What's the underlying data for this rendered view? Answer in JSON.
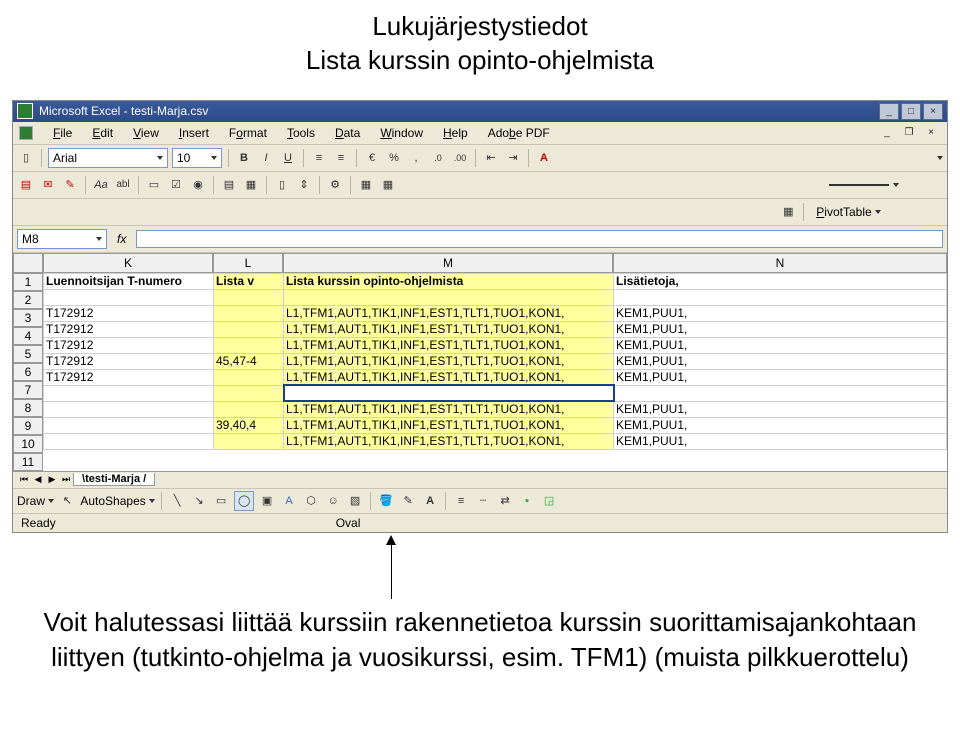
{
  "slide": {
    "title_line1": "Lukujärjestystiedot",
    "title_line2": "Lista kurssin opinto-ohjelmista",
    "caption_line1": "Voit halutessasi liittää kurssiin rakennetietoa kurssin suorittamisajankohtaan",
    "caption_line2": "liittyen (tutkinto-ohjelma ja vuosikurssi, esim. TFM1) (muista pilkkuerottelu)"
  },
  "window": {
    "title": "Microsoft Excel - testi-Marja.csv",
    "minimize": "_",
    "maximize": "□",
    "close": "×"
  },
  "menus": {
    "file": "File",
    "edit": "Edit",
    "view": "View",
    "insert": "Insert",
    "format": "Format",
    "tools": "Tools",
    "data": "Data",
    "window": "Window",
    "help": "Help",
    "adobe": "Adobe PDF"
  },
  "format_toolbar": {
    "font": "Arial",
    "size": "10",
    "bold": "B",
    "italic": "I",
    "underline": "U",
    "currency": "€",
    "percent": "%",
    "thousands": ",",
    "dec_inc": ".0",
    "dec_dec": ".00"
  },
  "font_letter": "A",
  "pivot": "PivotTable",
  "aa_label": "Aa",
  "abl_label": "abl",
  "namebox": "M8",
  "fx": "fx",
  "cols": {
    "K": "K",
    "L": "L",
    "M": "M",
    "N": "N"
  },
  "rows": [
    "1",
    "2",
    "3",
    "4",
    "5",
    "6",
    "7",
    "8",
    "9",
    "10",
    "11"
  ],
  "headers": {
    "K": "Luennoitsijan T-numero",
    "L": "Lista v",
    "M": "Lista kurssin opinto-ohjelmista",
    "N": "Lisätietoja,"
  },
  "data_rows": [
    {
      "K": "",
      "L": "",
      "M": "",
      "N": ""
    },
    {
      "K": "T172912",
      "L": "",
      "M": "L1,TFM1,AUT1,TIK1,INF1,EST1,TLT1,TUO1,KON1,",
      "N": "KEM1,PUU1,"
    },
    {
      "K": "T172912",
      "L": "",
      "M": "L1,TFM1,AUT1,TIK1,INF1,EST1,TLT1,TUO1,KON1,",
      "N": "KEM1,PUU1,"
    },
    {
      "K": "T172912",
      "L": "",
      "M": "L1,TFM1,AUT1,TIK1,INF1,EST1,TLT1,TUO1,KON1,",
      "N": "KEM1,PUU1,"
    },
    {
      "K": "T172912",
      "L": "45,47-4",
      "M": "L1,TFM1,AUT1,TIK1,INF1,EST1,TLT1,TUO1,KON1,",
      "N": "KEM1,PUU1,"
    },
    {
      "K": "T172912",
      "L": "",
      "M": "L1,TFM1,AUT1,TIK1,INF1,EST1,TLT1,TUO1,KON1,",
      "N": "KEM1,PUU1,"
    },
    {
      "K": "",
      "L": "",
      "M": "",
      "N": ""
    },
    {
      "K": "",
      "L": "",
      "M": "L1,TFM1,AUT1,TIK1,INF1,EST1,TLT1,TUO1,KON1,",
      "N": "KEM1,PUU1,"
    },
    {
      "K": "",
      "L": "39,40,4",
      "M": "L1,TFM1,AUT1,TIK1,INF1,EST1,TLT1,TUO1,KON1,",
      "N": "KEM1,PUU1,"
    },
    {
      "K": "",
      "L": "",
      "M": "L1,TFM1,AUT1,TIK1,INF1,EST1,TLT1,TUO1,KON1,",
      "N": "KEM1,PUU1,"
    }
  ],
  "sheet_tab": "testi-Marja",
  "draw": "Draw",
  "autoshapes": "AutoShapes",
  "status_ready": "Ready",
  "status_shape": "Oval"
}
